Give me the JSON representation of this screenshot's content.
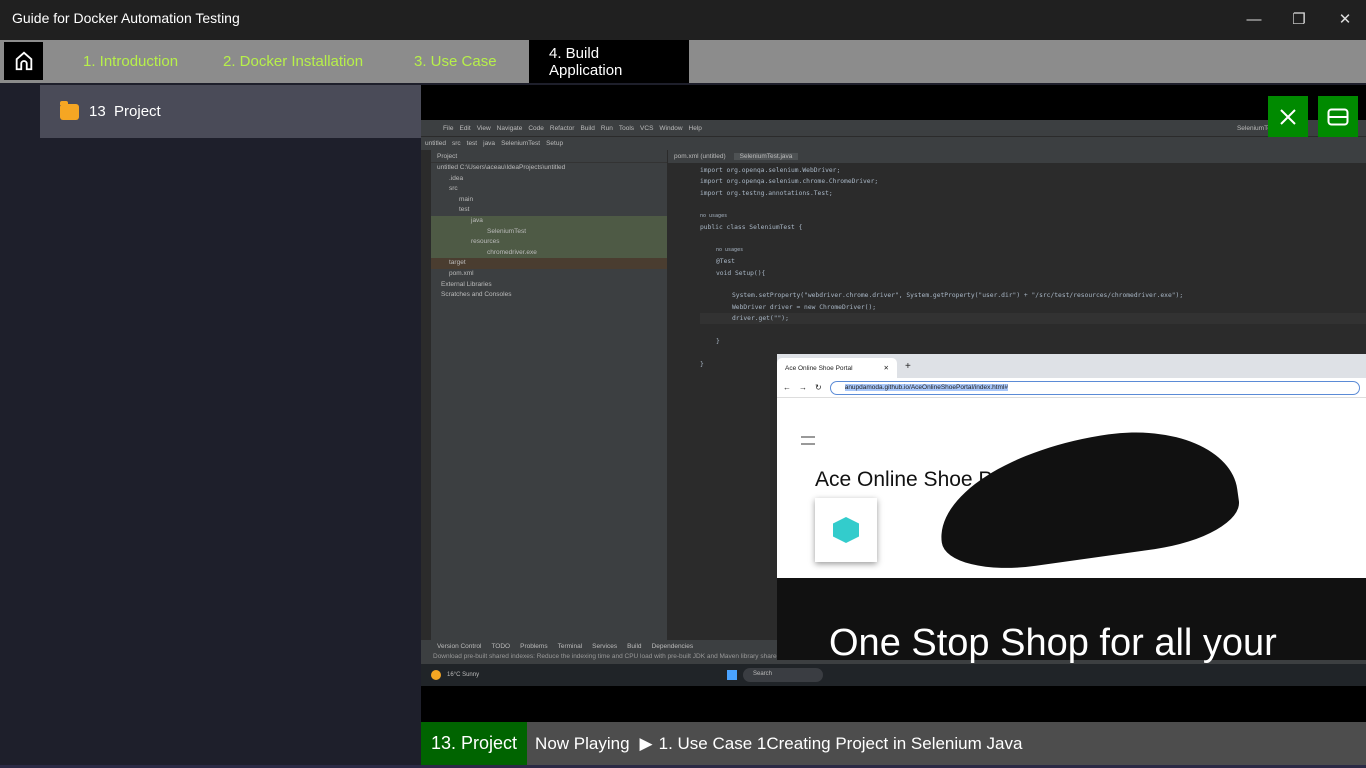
{
  "window": {
    "title": "Guide for Docker Automation Testing",
    "minimize": "—",
    "restore": "❐",
    "close": "✕"
  },
  "tabs": [
    {
      "label": "1. Introduction",
      "active": false
    },
    {
      "label": "2. Docker Installation",
      "active": false
    },
    {
      "label": "3. Use Case",
      "active": false
    },
    {
      "label": "4. Build Application",
      "active": true
    }
  ],
  "sidebar": {
    "items": [
      {
        "label": "13  Project",
        "icon": "folder-icon"
      }
    ]
  },
  "video": {
    "ide": {
      "menu": [
        "File",
        "Edit",
        "View",
        "Navigate",
        "Code",
        "Refactor",
        "Build",
        "Run",
        "Tools",
        "VCS",
        "Window",
        "Help"
      ],
      "breadcrumb": [
        "untitled",
        "src",
        "test",
        "java",
        "SeleniumTest",
        "Setup"
      ],
      "project_header": "Project",
      "tree": [
        "untitled  C:\\Users\\aceau\\IdeaProjects\\untitled",
        ".idea",
        "src",
        "main",
        "test",
        "java",
        "SeleniumTest",
        "resources",
        "chromedriver.exe",
        "target",
        "pom.xml",
        "External Libraries",
        "Scratches and Consoles"
      ],
      "editor_tabs": [
        "pom.xml (untitled)",
        "SeleniumTest.java"
      ],
      "code": {
        "l1": "import org.openqa.selenium.WebDriver;",
        "l2": "import org.openqa.selenium.chrome.ChromeDriver;",
        "l3": "import org.testng.annotations.Test;",
        "hint": "no usages",
        "l5": "public class SeleniumTest {",
        "l7": "@Test",
        "l8": "void Setup(){",
        "l10": "System.setProperty(\"webdriver.chrome.driver\", System.getProperty(\"user.dir\") + \"/src/test/resources/chromedriver.exe\");",
        "l11": "WebDriver driver = new ChromeDriver();",
        "l12": "driver.get(\"\");",
        "l14": "}",
        "l16": "}"
      },
      "status_tabs": [
        "Version Control",
        "TODO",
        "Problems",
        "Terminal",
        "Services",
        "Build",
        "Dependencies"
      ],
      "status_msg": "Download pre-built shared indexes: Reduce the indexing time and CPU load with pre-built JDK and Maven library shared indexes",
      "weather": "16°C Sunny",
      "search": "Search",
      "run_config": "SeleniumTest"
    },
    "browser": {
      "tab_title": "Ace Online Shoe Portal",
      "url": "anupdamoda.github.io/AceOnlineShoePortal/index.html#",
      "heading": "Ace Online Shoe Portal",
      "banner": "One Stop Shop for all your"
    }
  },
  "overlay": {
    "close_icon": "close-icon",
    "layout_icon": "panel-toggle-icon",
    "accent": "#008a00"
  },
  "now_playing": {
    "section": "13. Project",
    "label": "Now Playing",
    "title": "1. Use Case 1Creating Project in Selenium Java"
  }
}
